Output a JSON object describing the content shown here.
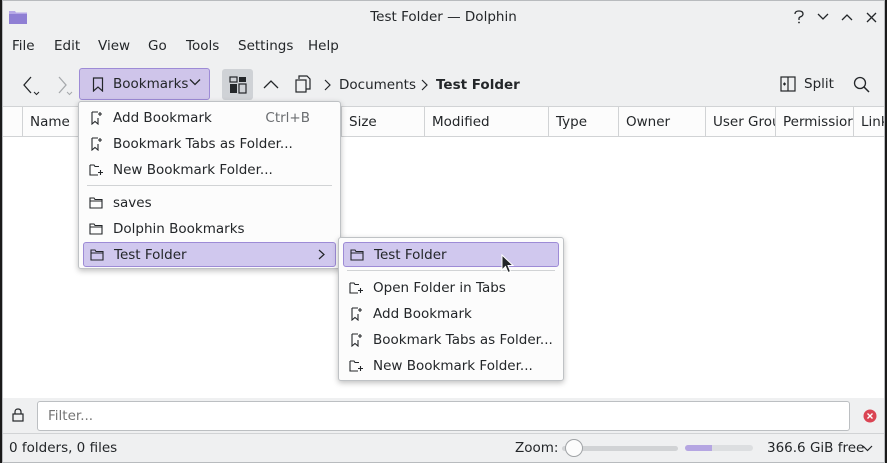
{
  "window": {
    "title": "Test Folder — Dolphin"
  },
  "menubar": [
    "File",
    "Edit",
    "View",
    "Go",
    "Tools",
    "Settings",
    "Help"
  ],
  "toolbar": {
    "bookmarks_label": "Bookmarks",
    "breadcrumb": [
      "Documents",
      "Test Folder"
    ],
    "split_label": "Split"
  },
  "columns": [
    "Name",
    "Size",
    "Modified",
    "Type",
    "Owner",
    "User Grou",
    "Permissior",
    "Link"
  ],
  "bookmarks_menu": {
    "add_bookmark": "Add Bookmark",
    "add_bookmark_shortcut": "Ctrl+B",
    "bookmark_tabs": "Bookmark Tabs as Folder...",
    "new_folder": "New Bookmark Folder...",
    "items": [
      "saves",
      "Dolphin Bookmarks",
      "Test Folder"
    ]
  },
  "submenu": {
    "open_folder": "Test Folder",
    "open_in_tabs": "Open Folder in Tabs",
    "add_bookmark": "Add Bookmark",
    "bookmark_tabs": "Bookmark Tabs as Folder...",
    "new_folder": "New Bookmark Folder..."
  },
  "filter": {
    "placeholder": "Filter..."
  },
  "status": {
    "counts": "0 folders, 0 files",
    "zoom_label": "Zoom:",
    "zoom_level": 0.05,
    "free_space": "366.6 GiB free",
    "used_fraction": 0.4
  },
  "colors": {
    "accent": "#cfc5ea",
    "accent_border": "#9d8bd6",
    "close_red": "#da4453"
  }
}
